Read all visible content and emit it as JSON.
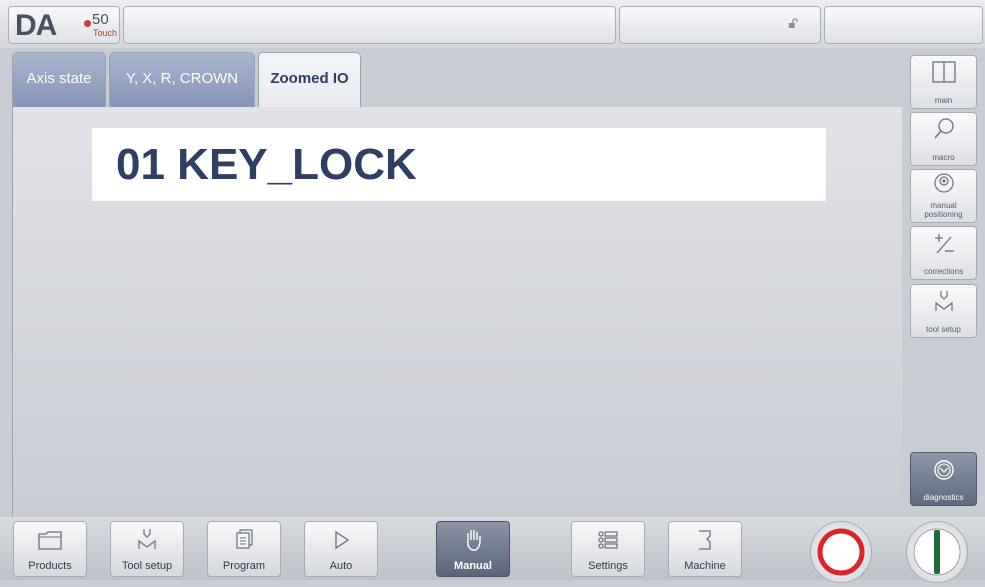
{
  "logo": {
    "brand": "DA",
    "model": "50",
    "variant": "Touch"
  },
  "tabs": [
    {
      "label": "Axis state",
      "active": false
    },
    {
      "label": "Y, X, R, CROWN",
      "active": false
    },
    {
      "label": "Zoomed IO",
      "active": true
    }
  ],
  "io_display": {
    "text": "01 KEY_LOCK"
  },
  "side_menu": [
    {
      "label": "main",
      "icon": "panel-icon"
    },
    {
      "label": "macro",
      "icon": "magnifier-icon"
    },
    {
      "label": "manual positioning",
      "icon": "handwheel-icon"
    },
    {
      "label": "corrections",
      "icon": "plus-minus-icon"
    },
    {
      "label": "tool setup",
      "icon": "punch-die-icon"
    },
    {
      "label": "diagnostics",
      "icon": "stethoscope-icon"
    }
  ],
  "bottom_nav": [
    {
      "label": "Products",
      "icon": "folder-icon",
      "active": false
    },
    {
      "label": "Tool setup",
      "icon": "punch-die-icon",
      "active": false
    },
    {
      "label": "Program",
      "icon": "pages-icon",
      "active": false
    },
    {
      "label": "Auto",
      "icon": "play-icon",
      "active": false
    },
    {
      "label": "Manual",
      "icon": "hand-icon",
      "active": true
    },
    {
      "label": "Settings",
      "icon": "list-icon",
      "active": false
    },
    {
      "label": "Machine",
      "icon": "machine-icon",
      "active": false
    }
  ],
  "colors": {
    "accent": "#2e3f63",
    "stop": "#d9262b",
    "start": "#1e6b3a",
    "tab": "#8fa0be"
  }
}
